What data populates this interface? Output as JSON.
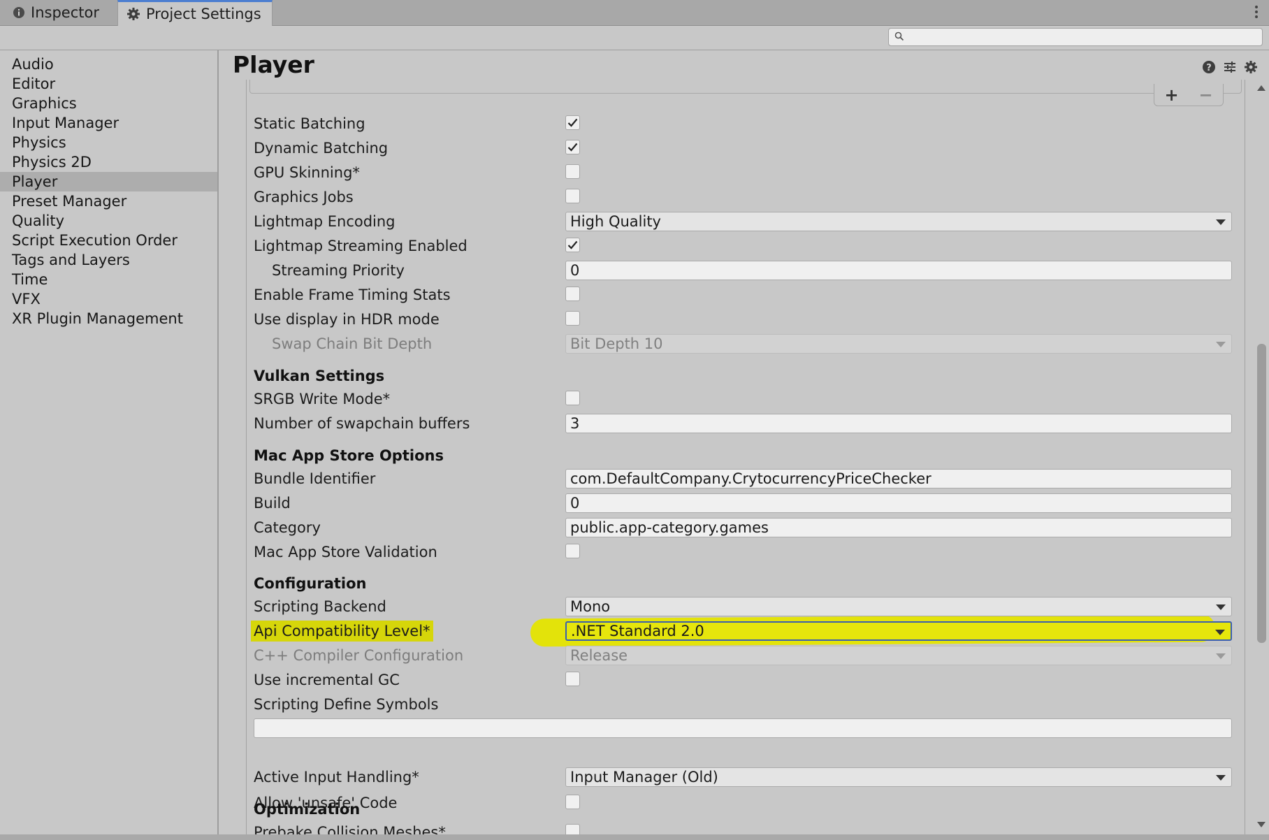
{
  "tabs": [
    {
      "label": "Inspector",
      "icon": "info-icon"
    },
    {
      "label": "Project Settings",
      "icon": "gear-icon",
      "active": true
    }
  ],
  "search": {
    "placeholder": "",
    "value": ""
  },
  "sidebar": {
    "items": [
      {
        "label": "Audio"
      },
      {
        "label": "Editor"
      },
      {
        "label": "Graphics"
      },
      {
        "label": "Input Manager"
      },
      {
        "label": "Physics"
      },
      {
        "label": "Physics 2D"
      },
      {
        "label": "Player",
        "selected": true
      },
      {
        "label": "Preset Manager"
      },
      {
        "label": "Quality"
      },
      {
        "label": "Script Execution Order"
      },
      {
        "label": "Tags and Layers"
      },
      {
        "label": "Time"
      },
      {
        "label": "VFX"
      },
      {
        "label": "XR Plugin Management"
      }
    ]
  },
  "main": {
    "title": "Player",
    "list_buttons": {
      "plus": "+",
      "minus": "−"
    },
    "rows": {
      "static_batching": {
        "label": "Static Batching",
        "checked": true
      },
      "dynamic_batching": {
        "label": "Dynamic Batching",
        "checked": true
      },
      "gpu_skinning": {
        "label": "GPU Skinning*",
        "checked": false
      },
      "graphics_jobs": {
        "label": "Graphics Jobs",
        "checked": false
      },
      "lightmap_encoding": {
        "label": "Lightmap Encoding",
        "value": "High Quality"
      },
      "lightmap_streaming": {
        "label": "Lightmap Streaming Enabled",
        "checked": true
      },
      "streaming_priority": {
        "label": "Streaming Priority",
        "value": "0"
      },
      "frame_timing": {
        "label": "Enable Frame Timing Stats",
        "checked": false
      },
      "hdr_mode": {
        "label": "Use display in HDR mode",
        "checked": false
      },
      "swap_chain": {
        "label": "Swap Chain Bit Depth",
        "value": "Bit Depth 10",
        "disabled": true
      },
      "vulkan_header": {
        "label": "Vulkan Settings"
      },
      "srgb_write": {
        "label": "SRGB Write Mode*",
        "checked": false
      },
      "swapchain_buffers": {
        "label": "Number of swapchain buffers",
        "value": "3"
      },
      "mac_header": {
        "label": "Mac App Store Options"
      },
      "bundle_id": {
        "label": "Bundle Identifier",
        "value": "com.DefaultCompany.CrytocurrencyPriceChecker"
      },
      "build": {
        "label": "Build",
        "value": "0"
      },
      "category": {
        "label": "Category",
        "value": "public.app-category.games"
      },
      "mac_validation": {
        "label": "Mac App Store Validation",
        "checked": false
      },
      "config_header": {
        "label": "Configuration"
      },
      "scripting_backend": {
        "label": "Scripting Backend",
        "value": "Mono"
      },
      "api_level": {
        "label": "Api Compatibility Level*",
        "value": ".NET Standard 2.0"
      },
      "cpp_compiler": {
        "label": "C++ Compiler Configuration",
        "value": "Release",
        "disabled": true
      },
      "incremental_gc": {
        "label": "Use incremental GC",
        "checked": false
      },
      "define_symbols": {
        "label": "Scripting Define Symbols",
        "value": ""
      },
      "unsafe_code": {
        "label": "Allow 'unsafe' Code",
        "checked": false
      },
      "input_handling": {
        "label": "Active Input Handling*",
        "value": "Input Manager (Old)"
      },
      "optimization_header": {
        "label": "Optimization"
      },
      "prebake_collision": {
        "label": "Prebake Collision Meshes*",
        "checked": false
      }
    }
  },
  "colors": {
    "highlight": "#e3e30a",
    "tab_accent": "#4c7ed0",
    "panel_bg": "#c8c8c8"
  }
}
